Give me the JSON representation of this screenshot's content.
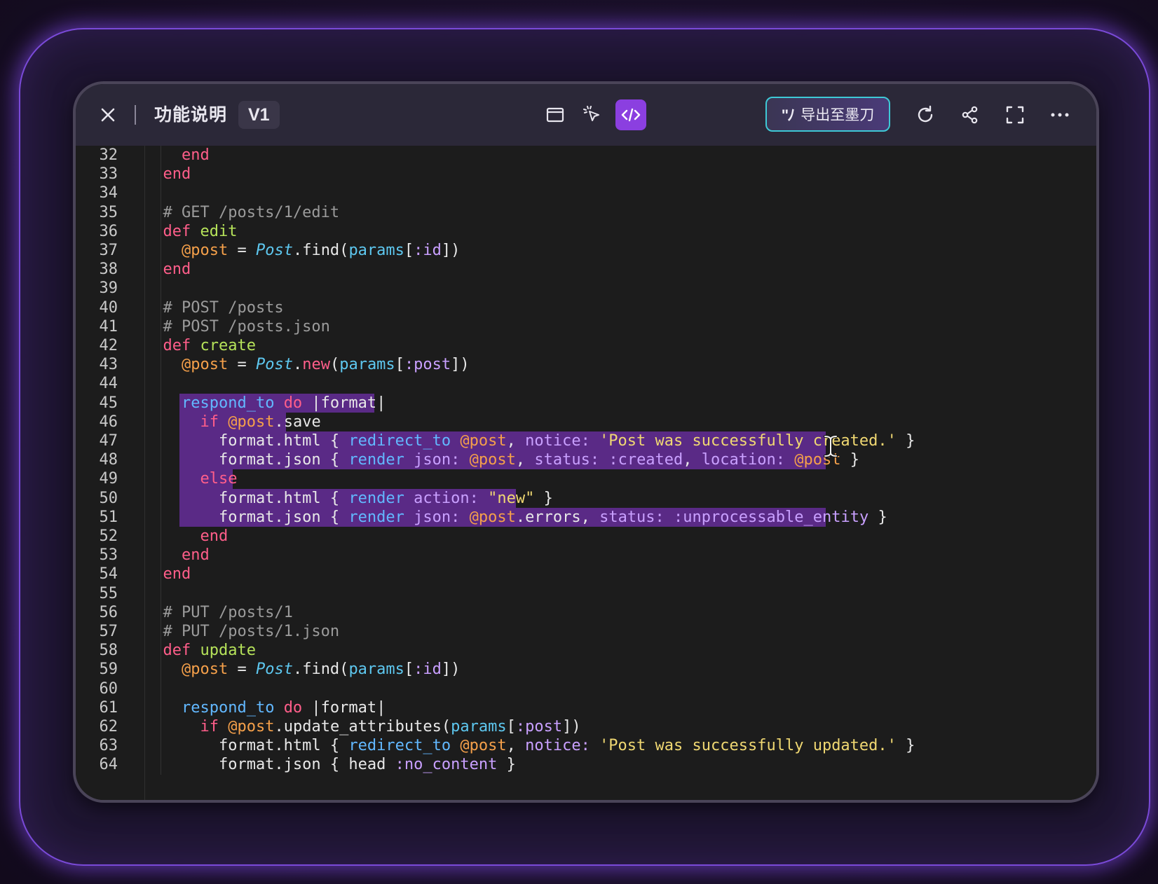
{
  "window": {
    "title": "功能说明",
    "version": "V1",
    "export_label": "导出至墨刀",
    "export_glyph": "\"ﾉ",
    "icons": [
      "close-icon",
      "preview-window-icon",
      "select-pointer-icon",
      "code-view-icon",
      "refresh-icon",
      "share-icon",
      "fullscreen-icon",
      "more-icon"
    ]
  },
  "colors": {
    "accent": "#8b3fe0",
    "export_border": "#3ec9d6",
    "keyword": "#ff5e8a",
    "method_name": "#b6e35a",
    "comment": "#9b9b9b",
    "ivar": "#f5a04a",
    "class": "#5ec8f0",
    "symbol": "#c9a0ff",
    "string": "#f0d872",
    "selection": "#5a2a86"
  },
  "code": {
    "lines": [
      {
        "n": "32",
        "t": "    end"
      },
      {
        "n": "33",
        "t": "  end"
      },
      {
        "n": "34",
        "t": ""
      },
      {
        "n": "35",
        "t": "  # GET /posts/1/edit"
      },
      {
        "n": "36",
        "t": "  def edit"
      },
      {
        "n": "37",
        "t": "    @post = Post.find(params[:id])"
      },
      {
        "n": "38",
        "t": "  end"
      },
      {
        "n": "39",
        "t": ""
      },
      {
        "n": "40",
        "t": "  # POST /posts"
      },
      {
        "n": "41",
        "t": "  # POST /posts.json"
      },
      {
        "n": "42",
        "t": "  def create"
      },
      {
        "n": "43",
        "t": "    @post = Post.new(params[:post])"
      },
      {
        "n": "44",
        "t": ""
      },
      {
        "n": "45",
        "t": "    respond_to do |format|"
      },
      {
        "n": "46",
        "t": "      if @post.save"
      },
      {
        "n": "47",
        "t": "        format.html { redirect_to @post, notice: 'Post was successfully created.' }"
      },
      {
        "n": "48",
        "t": "        format.json { render json: @post, status: :created, location: @post }"
      },
      {
        "n": "49",
        "t": "      else"
      },
      {
        "n": "50",
        "t": "        format.html { render action: \"new\" }"
      },
      {
        "n": "51",
        "t": "        format.json { render json: @post.errors, status: :unprocessable_entity }"
      },
      {
        "n": "52",
        "t": "      end"
      },
      {
        "n": "53",
        "t": "    end"
      },
      {
        "n": "54",
        "t": "  end"
      },
      {
        "n": "55",
        "t": ""
      },
      {
        "n": "56",
        "t": "  # PUT /posts/1"
      },
      {
        "n": "57",
        "t": "  # PUT /posts/1.json"
      },
      {
        "n": "58",
        "t": "  def update"
      },
      {
        "n": "59",
        "t": "    @post = Post.find(params[:id])"
      },
      {
        "n": "60",
        "t": ""
      },
      {
        "n": "61",
        "t": "    respond_to do |format|"
      },
      {
        "n": "62",
        "t": "      if @post.update_attributes(params[:post])"
      },
      {
        "n": "63",
        "t": "        format.html { redirect_to @post, notice: 'Post was successfully updated.' }"
      },
      {
        "n": "64",
        "t": "        format.json { head :no_content }"
      }
    ]
  }
}
